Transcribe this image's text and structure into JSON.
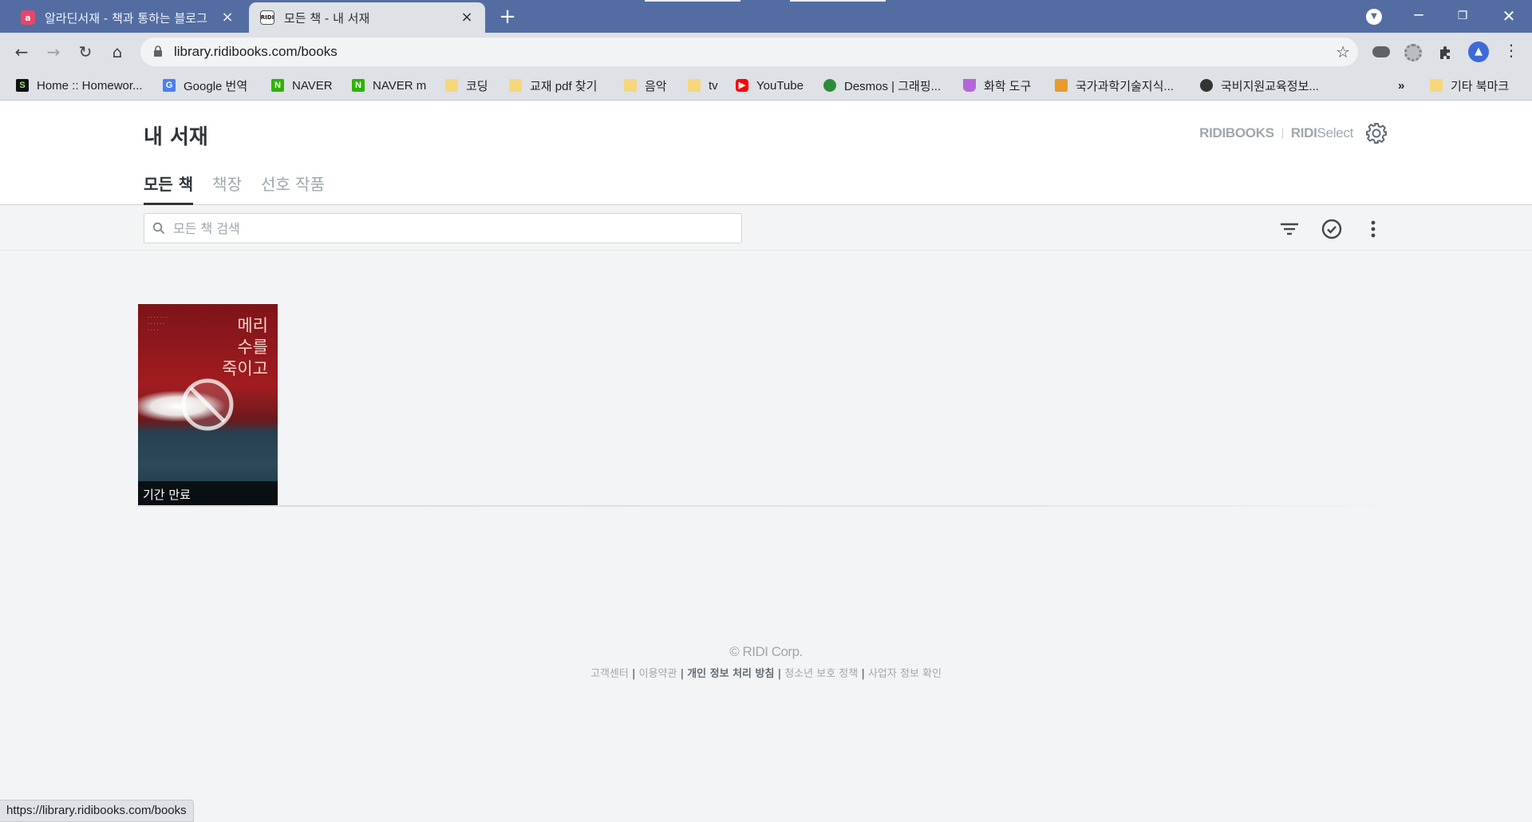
{
  "browser": {
    "tabs": [
      {
        "title": "알라딘서재 - 책과 통하는 블로그",
        "favicon": "aladin-icon"
      },
      {
        "title": "모든 책 - 내 서재",
        "favicon": "ridi-icon",
        "favicon_text": "RIDI"
      }
    ],
    "url": "library.ridibooks.com/books",
    "bookmarks": [
      {
        "label": "Home :: Homewor...",
        "icon": "s-icon"
      },
      {
        "label": "Google 번역",
        "icon": "google-translate-icon"
      },
      {
        "label": "NAVER",
        "icon": "naver-icon"
      },
      {
        "label": "NAVER m",
        "icon": "naver-icon"
      },
      {
        "label": "코딩",
        "icon": "folder-icon"
      },
      {
        "label": "교재 pdf 찾기",
        "icon": "folder-icon"
      },
      {
        "label": "음악",
        "icon": "folder-icon"
      },
      {
        "label": "tv",
        "icon": "folder-icon"
      },
      {
        "label": "YouTube",
        "icon": "youtube-icon"
      },
      {
        "label": "Desmos | 그래핑...",
        "icon": "desmos-icon"
      },
      {
        "label": "화학 도구",
        "icon": "flask-icon"
      },
      {
        "label": "국가과학기술지식...",
        "icon": "ntis-icon"
      },
      {
        "label": "국비지원교육정보...",
        "icon": "globe-icon"
      }
    ],
    "bookmarks_overflow": "»",
    "other_bookmarks": "기타 북마크",
    "status_url": "https://library.ridibooks.com/books"
  },
  "page": {
    "title": "내 서재",
    "service_links": {
      "ridibooks": "RIDIBOOKS",
      "ridi_select_bold": "RIDI",
      "ridi_select_light": "Select"
    },
    "tabs": [
      {
        "label": "모든 책",
        "active": true
      },
      {
        "label": "책장",
        "active": false
      },
      {
        "label": "선호 작품",
        "active": false
      }
    ],
    "search": {
      "placeholder": "모든 책 검색",
      "value": ""
    },
    "books": [
      {
        "cover_title": "메리 수를 죽이고",
        "cover_title_lines": [
          "메리",
          "수를",
          "죽이고"
        ],
        "status": "기간 만료"
      }
    ],
    "footer": {
      "copyright": "© RIDI Corp.",
      "links": [
        "고객센터",
        "이용약관",
        "개인 정보 처리 방침",
        "청소년 보호 정책",
        "사업자 정보 확인"
      ]
    }
  },
  "colors": {
    "tabbar": "#536da3",
    "chrome": "#dee1e6",
    "page_bg": "#f3f4f5",
    "text_dark": "#303538",
    "text_muted": "#9ea7ad"
  }
}
